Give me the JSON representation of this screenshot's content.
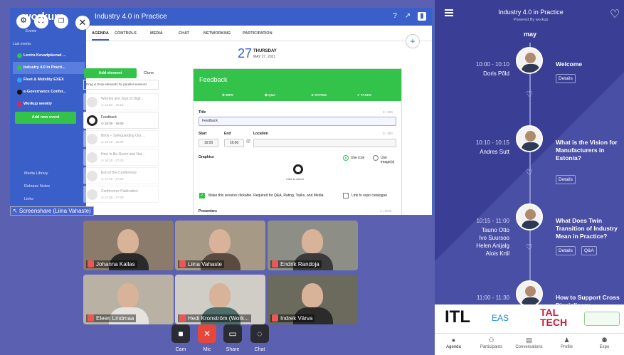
{
  "sidebar": {
    "logo": "workup",
    "events_label": "Events",
    "last_events_label": "Last events",
    "events": [
      {
        "label": "Lextra Kevadpäevad ...",
        "color": "#33c24a",
        "selected": false
      },
      {
        "label": "Industry 4.0 in Practi...",
        "color": "#33c24a",
        "selected": true
      },
      {
        "label": "Fleet & Mobility EXEX",
        "color": "#33a0ff",
        "selected": false
      },
      {
        "label": "e-Governance Confer...",
        "color": "#111111",
        "selected": false
      },
      {
        "label": "Workup weekly",
        "color": "#e0245e",
        "selected": false
      }
    ],
    "add_event": "Add new event",
    "links": [
      "Media Library",
      "Release Notes",
      "Links"
    ]
  },
  "app": {
    "title": "Industry 4.0 in Practice",
    "tabs": [
      "AGENDA",
      "CONTROLS",
      "MEDIA",
      "CHAT",
      "NETWORKING",
      "PARTICIPATION"
    ],
    "date_num": "27",
    "date_dow": "THURSDAY",
    "date_md": "MAY 27, 2021",
    "add_element": "Add element",
    "clone": "Clone",
    "dnd_hint": "Drag & Drop elements for parallel sessions",
    "cards": [
      {
        "t1": "Worries and Joys of Digit...",
        "t2": "⊙ 16:00 - 16:15",
        "dim": true
      },
      {
        "t1": "Feedback",
        "t2": "⊙ 16:00 - 16:00",
        "dim": false
      },
      {
        "t1": "Birdy – Safeguarding Our ...",
        "t2": "⊙ 16:15 - 16:30",
        "dim": true
      },
      {
        "t1": "How to Be Green and Not...",
        "t2": "⊙ 16:30 - 17:00",
        "dim": true
      },
      {
        "t1": "End of the Conference",
        "t2": "⊙ 17:00 - 17:00",
        "dim": true
      },
      {
        "t1": "Conference Publication",
        "t2": "⊙ 17:00 - 17:00",
        "dim": true
      }
    ]
  },
  "form": {
    "title": "Feedback",
    "tabs": [
      "✚ INFO",
      "☗ Q&A",
      "★ RATING",
      "✔ TASKS"
    ],
    "title_label": "Title",
    "title_count": "8 / 250",
    "title_value": "Feedback",
    "start_label": "Start",
    "end_label": "End",
    "location_label": "Location",
    "location_count": "0 / 250",
    "start_value": "16:00",
    "end_value": "16:00",
    "graphics_label": "Graphics",
    "use_icon": "Use icon",
    "use_images": "Use image(s)",
    "click_select": "Click to select",
    "clickable_text": "Make this session clickable. Required for Q&A, Rating, Tasks, and Media.",
    "expo_text": "Link to expo catalogue",
    "presenters_label": "Presenters",
    "presenters_count": "0 / 1000"
  },
  "screenshare_label": "↖ Screenshare (Liina Vahaste)",
  "participants": [
    {
      "name": "Johanna Kallas",
      "bg": "#8a7b6a",
      "shirt": "#2a2a2a"
    },
    {
      "name": "Liina Vahaste",
      "bg": "#a69a86",
      "shirt": "#5a4b40"
    },
    {
      "name": "Endrik Randoja",
      "bg": "#8d8f86",
      "shirt": "#3a3a3a"
    },
    {
      "name": "Eleen Lindmaa",
      "bg": "#b9b2a4",
      "shirt": "#e6e3df"
    },
    {
      "name": "Hedi Kronström (Work...",
      "bg": "#cfcdc6",
      "shirt": "#4f6d6a"
    },
    {
      "name": "Indrek Värva",
      "bg": "#6a6a5d",
      "shirt": "#2b2b2b"
    }
  ],
  "controls": [
    {
      "label": "Cam",
      "icon": "■",
      "red": false
    },
    {
      "label": "Mic",
      "icon": "✕",
      "red": true
    },
    {
      "label": "Share",
      "icon": "▭",
      "red": false
    },
    {
      "label": "Chat",
      "icon": "◌",
      "red": false
    }
  ],
  "panel": {
    "title": "Industry 4.0 in Practice",
    "powered": "Powered By workup",
    "month": "may",
    "slots": [
      {
        "time": "10:00 - 10:10",
        "who": [
          "Doris Põld"
        ],
        "title": "Welcome",
        "buttons": [
          "Details"
        ]
      },
      {
        "time": "10:10 - 10:15",
        "who": [
          "Andres Sutt"
        ],
        "title": "What is the Vision for Manufacturers in Estonia?",
        "buttons": [
          "Details"
        ]
      },
      {
        "time": "10:15 - 11:00",
        "who": [
          "Tauno Otto",
          "Ivo Suursoo",
          "Helen Anijalg",
          "Alois Krtil"
        ],
        "title": "What Does Twin Transition of Industry Mean in Practice?",
        "buttons": [
          "Details",
          "Q&A"
        ]
      },
      {
        "time": "11:00 - 11:30",
        "who": [],
        "title": "How to Support Cross Disciplinary",
        "buttons": []
      }
    ],
    "logos": [
      "ITL",
      "EAS",
      "TAL TECH"
    ],
    "nav": [
      {
        "label": "Agenda",
        "icon": "●"
      },
      {
        "label": "Participants",
        "icon": "⚇"
      },
      {
        "label": "Conversations",
        "icon": "▤"
      },
      {
        "label": "Profile",
        "icon": "♟"
      },
      {
        "label": "Expo",
        "icon": "⚉"
      }
    ]
  }
}
